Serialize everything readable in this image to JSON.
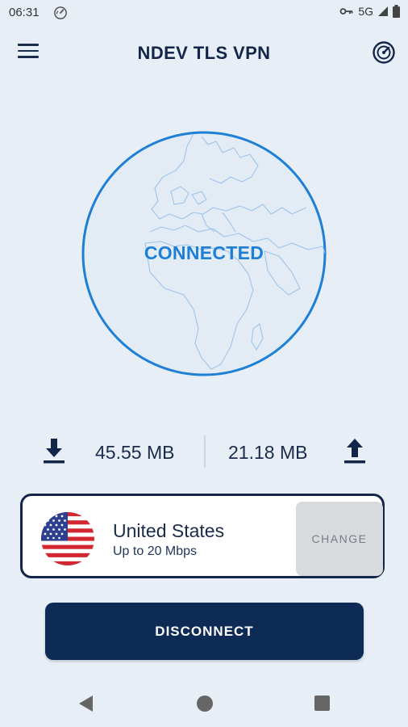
{
  "status_bar": {
    "time": "06:31",
    "network": "5G"
  },
  "app_bar": {
    "title": "NDEV TLS VPN",
    "menu_icon": "hamburger-menu-icon",
    "speed_icon": "speedometer-icon"
  },
  "connection": {
    "status": "CONNECTED",
    "accent_color": "#1e7fd6"
  },
  "traffic": {
    "download": "45.55 MB",
    "upload": "21.18 MB"
  },
  "server": {
    "country": "United States",
    "speed": "Up to 20 Mbps",
    "flag_icon": "us-flag-icon",
    "change_label": "CHANGE"
  },
  "actions": {
    "disconnect_label": "DISCONNECT",
    "button_color": "#0e2b55"
  }
}
